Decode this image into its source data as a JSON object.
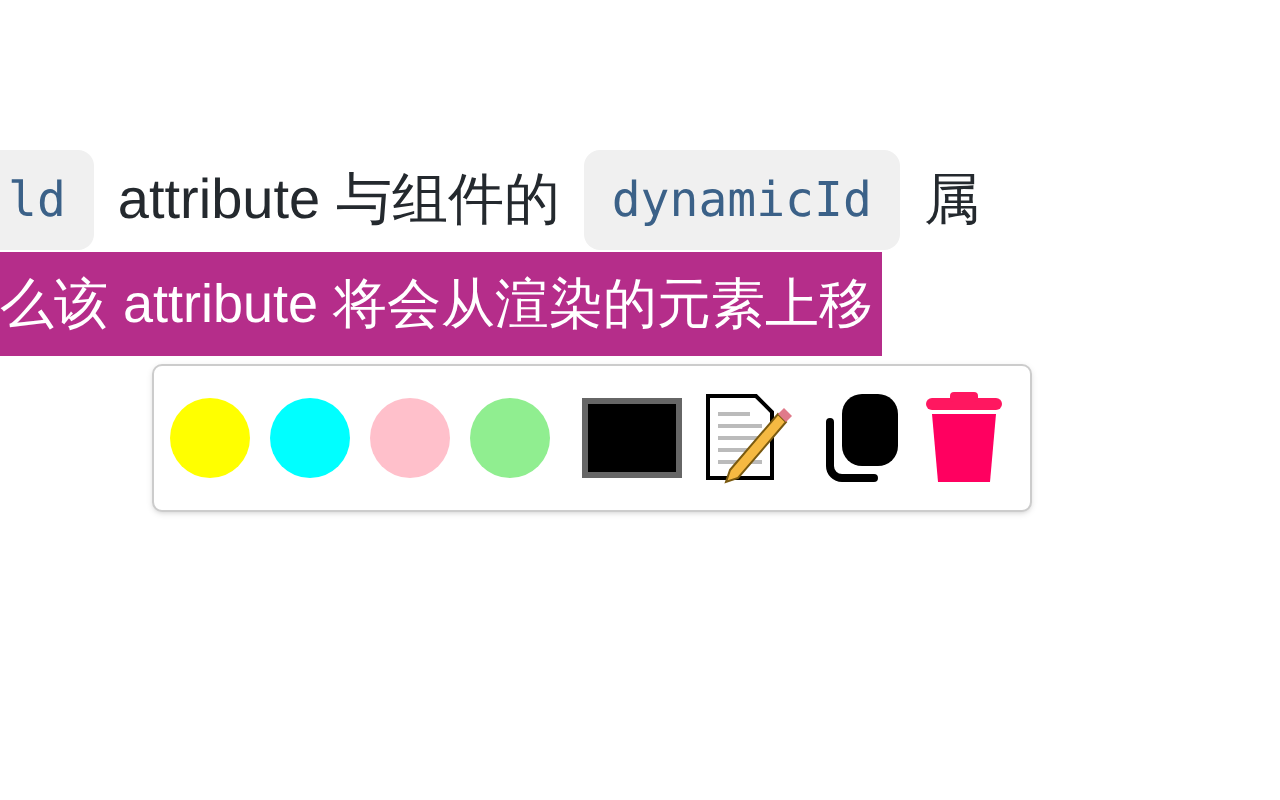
{
  "paragraph": {
    "line_1": [
      {
        "kind": "code",
        "text": "ld"
      },
      {
        "kind": "text",
        "text": "attribute 与组件的"
      },
      {
        "kind": "code",
        "text": "dynamicId"
      },
      {
        "kind": "text",
        "text": "属"
      }
    ],
    "line_2": {
      "text": "么该 attribute 将会从渲染的元素上移",
      "highlighted": true
    }
  },
  "toolbar": [
    {
      "kind": "swatch",
      "color": "#ffff00"
    },
    {
      "kind": "swatch",
      "color": "#00ffff"
    },
    {
      "kind": "swatch",
      "color": "#ffc0cb"
    },
    {
      "kind": "swatch",
      "color": "#90ee90"
    },
    {
      "kind": "square",
      "color": "#000000"
    },
    {
      "kind": "note"
    },
    {
      "kind": "copy"
    },
    {
      "kind": "delete"
    }
  ]
}
